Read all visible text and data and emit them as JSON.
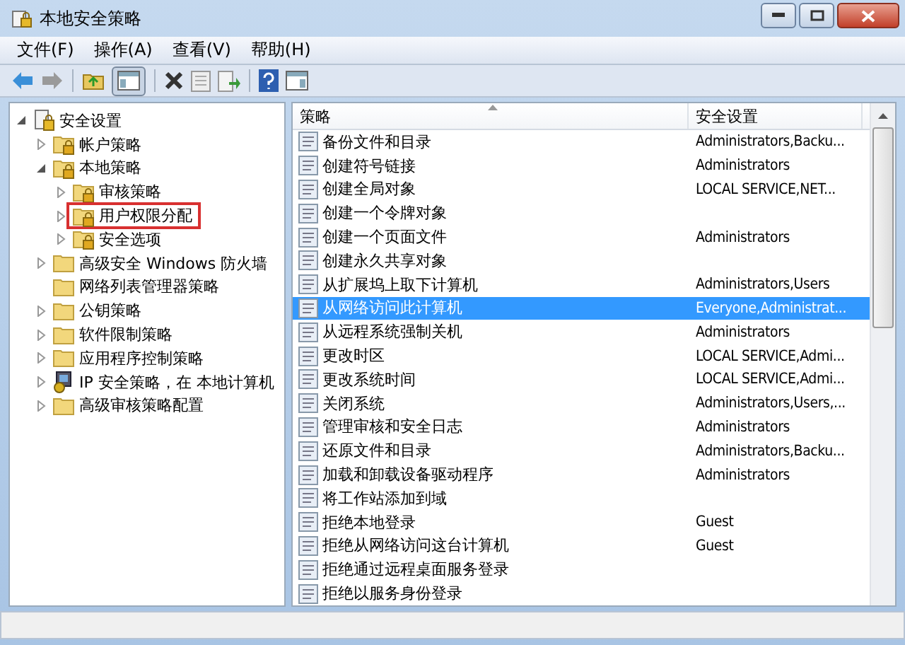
{
  "window": {
    "title": "本地安全策略"
  },
  "menu": [
    "文件(F)",
    "操作(A)",
    "查看(V)",
    "帮助(H)"
  ],
  "tree": [
    {
      "label": "安全设置",
      "kind": "root",
      "expanded": true,
      "children": [
        {
          "label": "帐户策略",
          "kind": "lockfolder",
          "expanded": false
        },
        {
          "label": "本地策略",
          "kind": "lockfolder",
          "expanded": true,
          "children": [
            {
              "label": "审核策略",
              "kind": "lockfolder",
              "expanded": false
            },
            {
              "label": "用户权限分配",
              "kind": "lockfolder",
              "expanded": false,
              "highlighted": true
            },
            {
              "label": "安全选项",
              "kind": "lockfolder",
              "expanded": false
            }
          ]
        },
        {
          "label": "高级安全 Windows 防火墙",
          "kind": "folder",
          "expanded": false
        },
        {
          "label": "网络列表管理器策略",
          "kind": "folder"
        },
        {
          "label": "公钥策略",
          "kind": "folder",
          "expanded": false
        },
        {
          "label": "软件限制策略",
          "kind": "folder",
          "expanded": false
        },
        {
          "label": "应用程序控制策略",
          "kind": "folder",
          "expanded": false
        },
        {
          "label": "IP 安全策略，在 本地计算机",
          "kind": "ip",
          "expanded": false
        },
        {
          "label": "高级审核策略配置",
          "kind": "folder",
          "expanded": false
        }
      ]
    }
  ],
  "table": {
    "columns": [
      "策略",
      "安全设置"
    ],
    "rows": [
      {
        "policy": "备份文件和目录",
        "setting": "Administrators,Backu...",
        "selected": false
      },
      {
        "policy": "创建符号链接",
        "setting": "Administrators",
        "selected": false
      },
      {
        "policy": "创建全局对象",
        "setting": "LOCAL SERVICE,NET...",
        "selected": false
      },
      {
        "policy": "创建一个令牌对象",
        "selected": false
      },
      {
        "policy": "创建一个页面文件",
        "setting": "Administrators",
        "selected": false
      },
      {
        "policy": "创建永久共享对象",
        "selected": false
      },
      {
        "policy": "从扩展坞上取下计算机",
        "setting": "Administrators,Users",
        "selected": false
      },
      {
        "policy": "从网络访问此计算机",
        "setting": "Everyone,Administrat...",
        "selected": true
      },
      {
        "policy": "从远程系统强制关机",
        "setting": "Administrators",
        "selected": false
      },
      {
        "policy": "更改时区",
        "setting": "LOCAL SERVICE,Admi...",
        "selected": false
      },
      {
        "policy": "更改系统时间",
        "setting": "LOCAL SERVICE,Admi...",
        "selected": false
      },
      {
        "policy": "关闭系统",
        "setting": "Administrators,Users,...",
        "selected": false
      },
      {
        "policy": "管理审核和安全日志",
        "setting": "Administrators",
        "selected": false
      },
      {
        "policy": "还原文件和目录",
        "setting": "Administrators,Backu...",
        "selected": false
      },
      {
        "policy": "加载和卸载设备驱动程序",
        "setting": "Administrators",
        "selected": false
      },
      {
        "policy": "将工作站添加到域",
        "selected": false
      },
      {
        "policy": "拒绝本地登录",
        "setting": "Guest",
        "selected": false
      },
      {
        "policy": "拒绝从网络访问这台计算机",
        "setting": "Guest",
        "selected": false
      },
      {
        "policy": "拒绝通过远程桌面服务登录",
        "selected": false
      },
      {
        "policy": "拒绝以服务身份登录",
        "selected": false
      }
    ]
  }
}
